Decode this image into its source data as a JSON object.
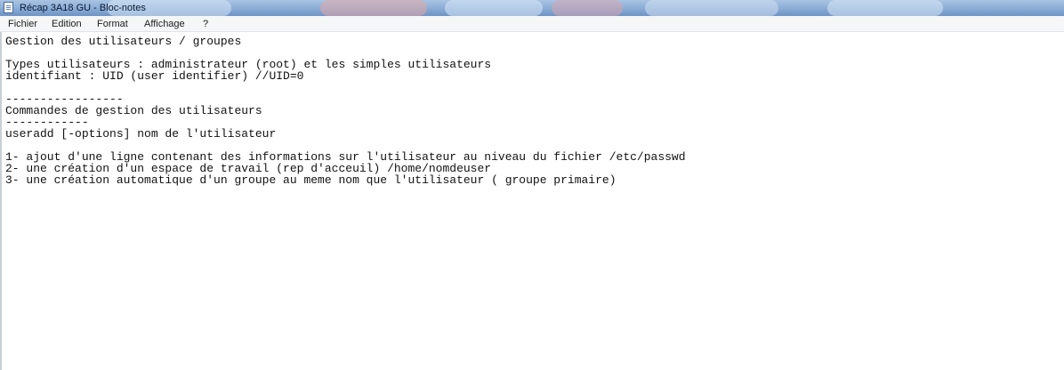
{
  "window": {
    "title": "Récap 3A18 GU - Bloc-notes"
  },
  "menu": {
    "items": [
      "Fichier",
      "Edition",
      "Format",
      "Affichage",
      "?"
    ]
  },
  "editor": {
    "lines": [
      "Gestion des utilisateurs / groupes",
      "Types utilisateurs : administrateur (root) et les simples utilisateurs",
      "identifiant : UID (user identifier) //UID=0",
      "-----------------",
      "Commandes de gestion des utilisateurs",
      "------------",
      "useradd [-options] nom de l'utilisateur",
      "1- ajout d'une ligne contenant des informations sur l'utilisateur au niveau du fichier /etc/passwd",
      "2- une création d'un espace de travail (rep d'acceuil) /home/nomdeuser",
      "3- une création automatique d'un groupe au meme nom que l'utilisateur ( groupe primaire)"
    ]
  }
}
